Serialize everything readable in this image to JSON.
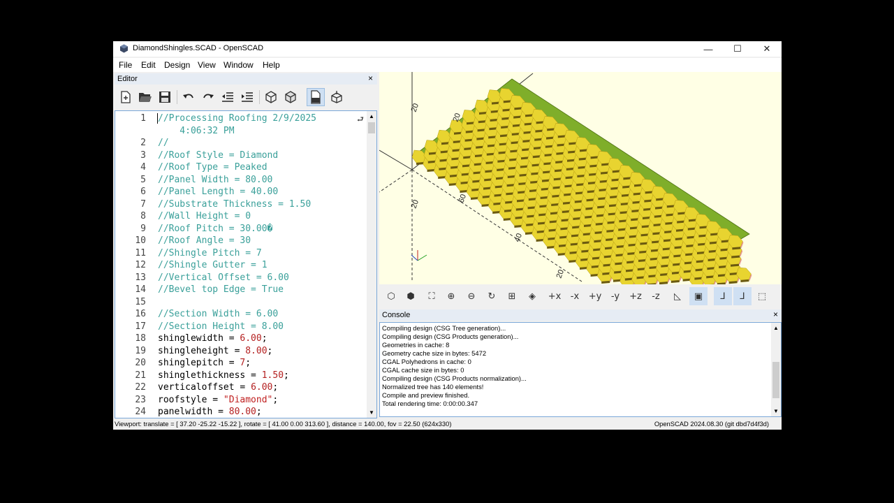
{
  "window": {
    "title": "DiamondShingles.SCAD - OpenSCAD",
    "minimize": "—",
    "maximize": "☐",
    "close": "✕"
  },
  "menu": [
    "File",
    "Edit",
    "Design",
    "View",
    "Window",
    "Help"
  ],
  "editor": {
    "title": "Editor",
    "close": "×",
    "toolbar_icons": [
      "new-file-icon",
      "open-file-icon",
      "save-icon",
      "undo-icon",
      "redo-icon",
      "unindent-icon",
      "indent-icon",
      "preview-icon",
      "render-icon",
      "export-stl-icon",
      "send-to-print-icon"
    ],
    "lines": [
      {
        "n": "1",
        "parts": [
          {
            "t": "//Processing Roofing 2/9/2025",
            "c": "comment"
          }
        ]
      },
      {
        "n": "",
        "parts": [
          {
            "t": "    4:06:32 PM",
            "c": "comment"
          }
        ]
      },
      {
        "n": "2",
        "parts": [
          {
            "t": "//",
            "c": "comment"
          }
        ]
      },
      {
        "n": "3",
        "parts": [
          {
            "t": "//Roof Style = Diamond",
            "c": "comment"
          }
        ]
      },
      {
        "n": "4",
        "parts": [
          {
            "t": "//Roof Type = Peaked",
            "c": "comment"
          }
        ]
      },
      {
        "n": "5",
        "parts": [
          {
            "t": "//Panel Width = 80.00",
            "c": "comment"
          }
        ]
      },
      {
        "n": "6",
        "parts": [
          {
            "t": "//Panel Length = 40.00",
            "c": "comment"
          }
        ]
      },
      {
        "n": "7",
        "parts": [
          {
            "t": "//Substrate Thickness = 1.50",
            "c": "comment"
          }
        ]
      },
      {
        "n": "8",
        "parts": [
          {
            "t": "//Wall Height = 0",
            "c": "comment"
          }
        ]
      },
      {
        "n": "9",
        "parts": [
          {
            "t": "//Roof Pitch = 30.00�",
            "c": "comment"
          }
        ]
      },
      {
        "n": "10",
        "parts": [
          {
            "t": "//Roof Angle = 30",
            "c": "comment"
          }
        ]
      },
      {
        "n": "11",
        "parts": [
          {
            "t": "//Shingle Pitch = 7",
            "c": "comment"
          }
        ]
      },
      {
        "n": "12",
        "parts": [
          {
            "t": "//Shingle Gutter = 1",
            "c": "comment"
          }
        ]
      },
      {
        "n": "13",
        "parts": [
          {
            "t": "//Vertical Offset = 6.00",
            "c": "comment"
          }
        ]
      },
      {
        "n": "14",
        "parts": [
          {
            "t": "//Bevel top Edge = True",
            "c": "comment"
          }
        ]
      },
      {
        "n": "15",
        "parts": []
      },
      {
        "n": "16",
        "parts": [
          {
            "t": "//Section Width = 6.00",
            "c": "comment"
          }
        ]
      },
      {
        "n": "17",
        "parts": [
          {
            "t": "//Section Height = 8.00",
            "c": "comment"
          }
        ]
      },
      {
        "n": "18",
        "parts": [
          {
            "t": "shinglewidth = ",
            "c": "plain"
          },
          {
            "t": "6.00",
            "c": "num"
          },
          {
            "t": ";",
            "c": "plain"
          }
        ]
      },
      {
        "n": "19",
        "parts": [
          {
            "t": "shingleheight = ",
            "c": "plain"
          },
          {
            "t": "8.00",
            "c": "num"
          },
          {
            "t": ";",
            "c": "plain"
          }
        ]
      },
      {
        "n": "20",
        "parts": [
          {
            "t": "shinglepitch = ",
            "c": "plain"
          },
          {
            "t": "7",
            "c": "num"
          },
          {
            "t": ";",
            "c": "plain"
          }
        ]
      },
      {
        "n": "21",
        "parts": [
          {
            "t": "shinglethickness = ",
            "c": "plain"
          },
          {
            "t": "1.50",
            "c": "num"
          },
          {
            "t": ";",
            "c": "plain"
          }
        ]
      },
      {
        "n": "22",
        "parts": [
          {
            "t": "verticaloffset = ",
            "c": "plain"
          },
          {
            "t": "6.00",
            "c": "num"
          },
          {
            "t": ";",
            "c": "plain"
          }
        ]
      },
      {
        "n": "23",
        "parts": [
          {
            "t": "roofstyle = ",
            "c": "plain"
          },
          {
            "t": "\"Diamond\"",
            "c": "str"
          },
          {
            "t": ";",
            "c": "plain"
          }
        ]
      },
      {
        "n": "24",
        "parts": [
          {
            "t": "panelwidth = ",
            "c": "plain"
          },
          {
            "t": "80.00",
            "c": "num"
          },
          {
            "t": ";",
            "c": "plain"
          }
        ]
      }
    ]
  },
  "viewport": {
    "background": "#ffffe5",
    "shingle_color": "#e8d430",
    "axis_labels": [
      "20",
      "20",
      "20",
      "40",
      "60",
      "20"
    ]
  },
  "view_toolbar_icons": [
    "preview-icon",
    "render-icon",
    "view-all-icon",
    "zoom-in-icon",
    "zoom-out-icon",
    "reset-view-icon",
    "view-center-icon",
    "view-diagonal-icon",
    "view-right-icon",
    "view-left-icon",
    "view-front-icon",
    "view-back-icon",
    "view-top-icon",
    "view-bottom-icon",
    "perspective-icon",
    "orthogonal-icon",
    "show-axes-icon",
    "show-scale-icon",
    "show-edges-icon"
  ],
  "console": {
    "title": "Console",
    "close": "×",
    "lines": [
      "Compiling design (CSG Tree generation)...",
      "Compiling design (CSG Products generation)...",
      "Geometries in cache: 8",
      "Geometry cache size in bytes: 5472",
      "CGAL Polyhedrons in cache: 0",
      "CGAL cache size in bytes: 0",
      "Compiling design (CSG Products normalization)...",
      "Normalized tree has 140 elements!",
      "Compile and preview finished.",
      "Total rendering time: 0:00:00.347"
    ]
  },
  "status": {
    "left": "Viewport: translate = [ 37.20 -25.22 -15.22 ], rotate = [ 41.00 0.00 313.60 ], distance = 140.00, fov = 22.50 (624x330)",
    "right": "OpenSCAD 2024.08.30 (git dbd7d4f3d)"
  }
}
